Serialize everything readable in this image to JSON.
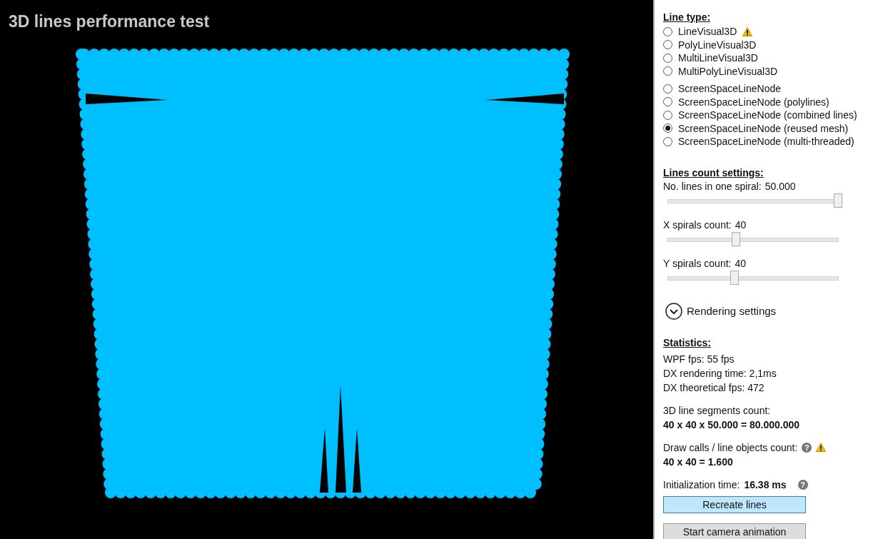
{
  "viewport": {
    "title": "3D lines performance test"
  },
  "line_type": {
    "title": "Line type:",
    "groups": [
      {
        "options": [
          {
            "label": "LineVisual3D",
            "selected": false,
            "warning": true
          },
          {
            "label": "PolyLineVisual3D",
            "selected": false,
            "warning": false
          },
          {
            "label": "MultiLineVisual3D",
            "selected": false,
            "warning": false
          },
          {
            "label": "MultiPolyLineVisual3D",
            "selected": false,
            "warning": false
          }
        ]
      },
      {
        "options": [
          {
            "label": "ScreenSpaceLineNode",
            "selected": false,
            "warning": false
          },
          {
            "label": "ScreenSpaceLineNode (polylines)",
            "selected": false,
            "warning": false
          },
          {
            "label": "ScreenSpaceLineNode (combined lines)",
            "selected": false,
            "warning": false
          },
          {
            "label": "ScreenSpaceLineNode (reused mesh)",
            "selected": true,
            "warning": false
          },
          {
            "label": "ScreenSpaceLineNode (multi-threaded)",
            "selected": false,
            "warning": false
          }
        ]
      }
    ]
  },
  "lines_count": {
    "title": "Lines count settings:",
    "sliders": [
      {
        "label": "No. lines in one spiral:",
        "value": "50.000",
        "level": 1.0
      },
      {
        "label": "X spirals count:",
        "value": "40",
        "level": 0.4
      },
      {
        "label": "Y spirals count:",
        "value": "40",
        "level": 0.39
      }
    ]
  },
  "rendering_settings": {
    "label": "Rendering settings",
    "expanded": false
  },
  "statistics": {
    "title": "Statistics:",
    "lines": [
      "WPF fps: 55 fps",
      "DX rendering time: 2,1ms",
      "DX theoretical fps: 472"
    ],
    "segments": {
      "label": "3D line segments count:",
      "value": "40 x 40 x 50.000 = 80.000.000"
    },
    "draw_calls": {
      "label": "Draw calls / line objects count:",
      "value": "40 x 40 = 1.600",
      "help": "?",
      "warning": true
    },
    "init": {
      "label": "Initialization time:",
      "value": "16.38 ms",
      "help": "?"
    }
  },
  "buttons": [
    {
      "label": "Recreate lines",
      "highlighted": true
    },
    {
      "label": "Start camera animation",
      "highlighted": false
    }
  ]
}
